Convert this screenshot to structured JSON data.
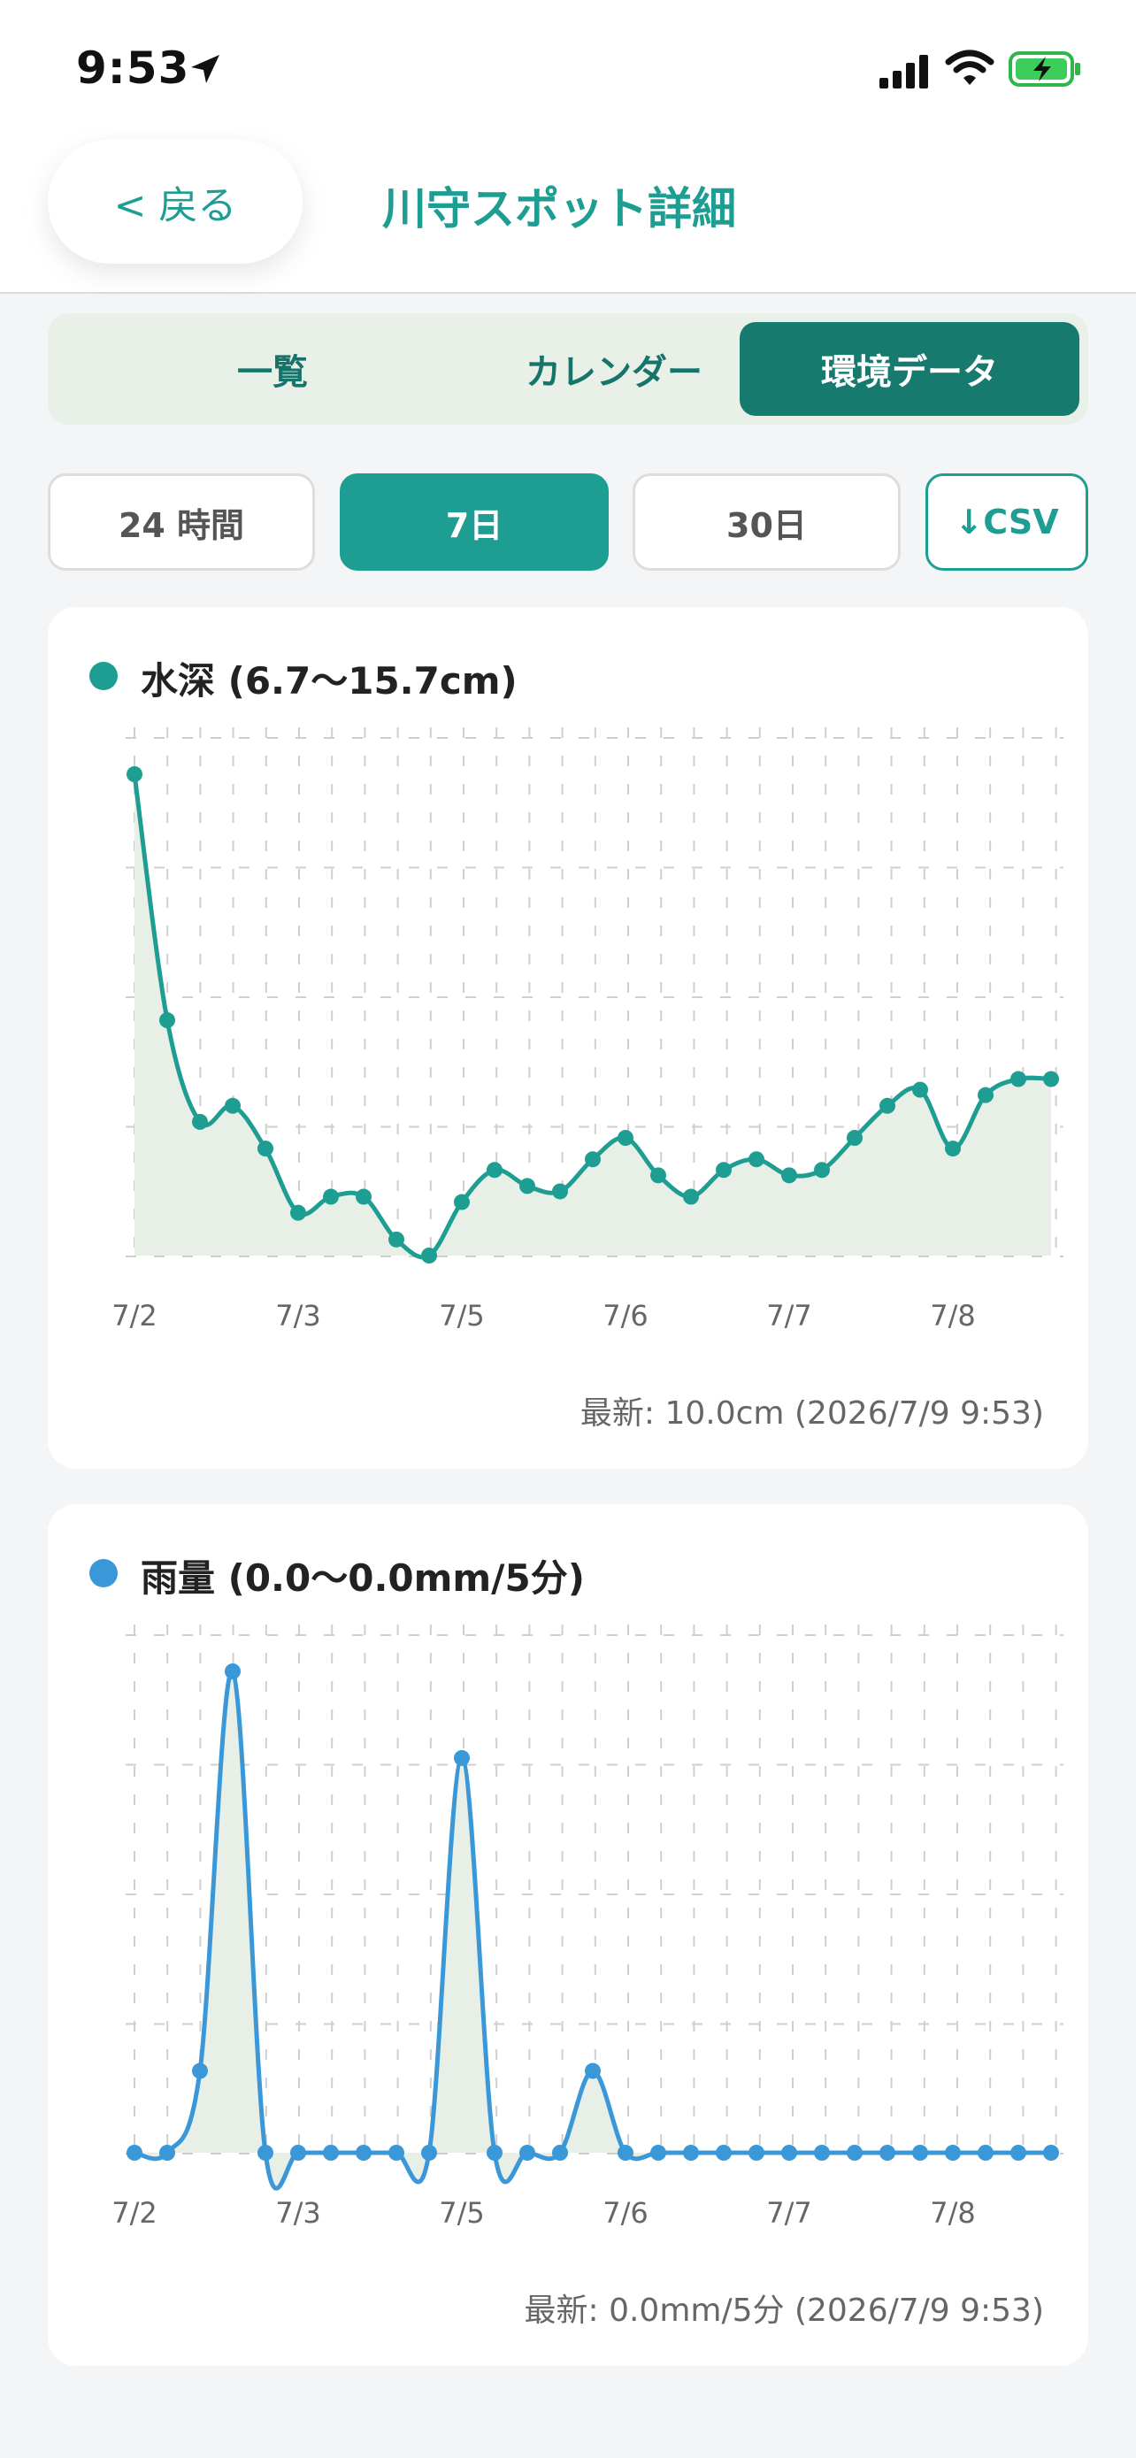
{
  "status_bar": {
    "time": "9:53"
  },
  "header": {
    "back_label": "< 戻る",
    "title": "川守スポット詳細"
  },
  "tabs": [
    {
      "label": "一覧",
      "active": false
    },
    {
      "label": "カレンダー",
      "active": false
    },
    {
      "label": "環境データ",
      "active": true
    }
  ],
  "periods": [
    {
      "label": "24 時間",
      "active": false
    },
    {
      "label": "7日",
      "active": true
    },
    {
      "label": "30日",
      "active": false
    }
  ],
  "csv_label": "↓CSV",
  "colors": {
    "accent": "#1e9e92",
    "accent_dark": "#167a6f",
    "rain": "#3a97d8",
    "fill": "#e8efe6"
  },
  "chart_data": [
    {
      "type": "line",
      "title": "水深 (6.7〜15.7cm)",
      "x_tick_labels": [
        "7/2",
        "7/3",
        "7/5",
        "7/6",
        "7/7",
        "7/8"
      ],
      "series": [
        {
          "values": [
            15.7,
            11.1,
            9.2,
            9.5,
            8.7,
            7.5,
            7.8,
            7.8,
            7.0,
            6.7,
            7.7,
            8.3,
            8.0,
            7.9,
            8.5,
            8.9,
            8.2,
            7.8,
            8.3,
            8.5,
            8.2,
            8.3,
            8.9,
            9.5,
            9.8,
            8.7,
            9.7,
            10.0,
            10.0
          ]
        }
      ],
      "ylim": [
        6.7,
        15.7
      ],
      "grid": true,
      "latest": "最新: 10.0cm (2026/7/9 9:53)"
    },
    {
      "type": "line",
      "title": "雨量 (0.0〜0.0mm/5分)",
      "x_tick_labels": [
        "7/2",
        "7/3",
        "7/5",
        "7/6",
        "7/7",
        "7/8"
      ],
      "series": [
        {
          "values": [
            0.0,
            0.0,
            0.0017,
            0.01,
            0.0,
            0.0,
            0.0,
            0.0,
            0.0,
            0.0,
            0.0082,
            0.0,
            0.0,
            0.0,
            0.0017,
            0.0,
            0.0,
            0.0,
            0.0,
            0.0,
            0.0,
            0.0,
            0.0,
            0.0,
            0.0,
            0.0,
            0.0,
            0.0,
            0.0
          ]
        }
      ],
      "ylim": [
        0,
        0.01
      ],
      "grid": true,
      "latest": "最新: 0.0mm/5分 (2026/7/9 9:53)"
    }
  ]
}
